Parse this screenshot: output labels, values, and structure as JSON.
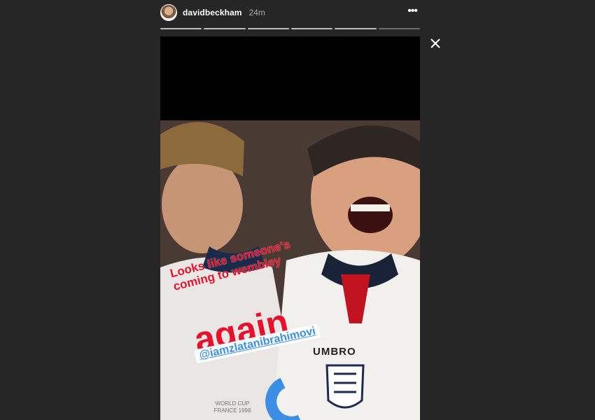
{
  "story": {
    "username": "davidbeckham",
    "time": "24m",
    "segments": 6,
    "current_segment": 6
  },
  "overlay": {
    "caption_line1": "Looks like someone's",
    "caption_line2": "coming to wembley",
    "big_word": "again",
    "mention": "@iamzlatanibrahimovi",
    "shirt_brand": "UMBRO",
    "shirt_text_line1": "WORLD CUP",
    "shirt_text_line2": "FRANCE 1998"
  },
  "icons": {
    "more": "more-dots-icon",
    "close": "close-icon"
  },
  "colors": {
    "background": "#262626",
    "caption_red": "#e8102a",
    "mention_blue": "#3b8ee6"
  }
}
